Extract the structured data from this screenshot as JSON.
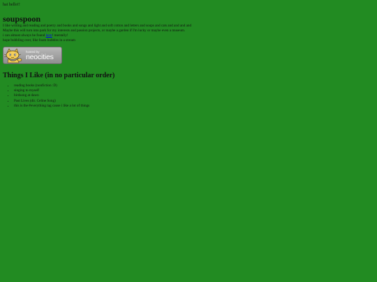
{
  "greeting": "hai hello!!",
  "title": "soupspoon",
  "paragraphs": {
    "p1": "I like writing and reading and poetry and books and songs and light and soft cotton and letters and soups and cats and and and and",
    "p2": "Maybe this will turn into park for my interests and passion projects, or maybe a garden if I'm lucky or maybe even a museum.",
    "p3_before": "i can almost always be found ",
    "p3_link": "here",
    "p3_after": "! mentally!",
    "p4": "hope bubbling over, like foam bubbles in a stream"
  },
  "badge": {
    "hosted_label": "hosted by",
    "brand_label": "neocities"
  },
  "likes": {
    "heading": "Things I Like (in no particular order)",
    "items": [
      "reading books (nonfiction :D)",
      "singing to myself",
      "birdsong at dawn",
      "Past Lives (dir. Celine Song)",
      "this is the #everything tag cause i like a lot of things"
    ]
  },
  "colors": {
    "background": "#228b22",
    "text": "#111111",
    "link": "#0000ee",
    "badge": "#a3a3a3"
  },
  "icons": {
    "badge_mascot": "neocities-cat-mascot-icon"
  }
}
